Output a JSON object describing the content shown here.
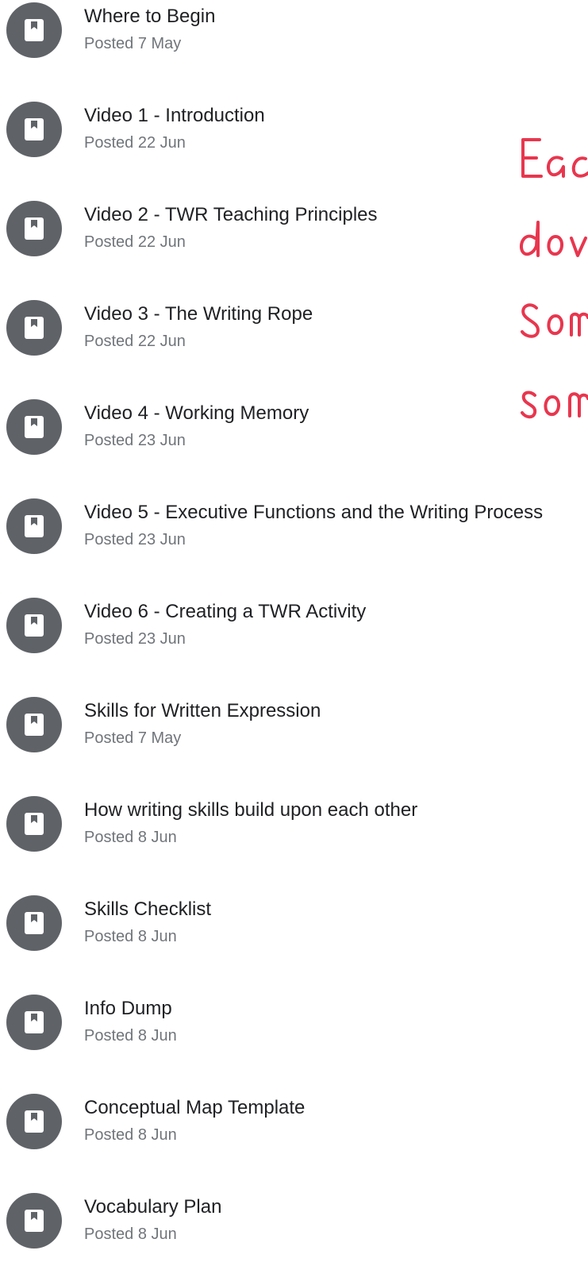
{
  "materials": [
    {
      "title": "Where to Begin",
      "date": "Posted 7 May"
    },
    {
      "title": "Video 1 - Introduction",
      "date": "Posted 22 Jun"
    },
    {
      "title": "Video 2 - TWR Teaching Principles",
      "date": "Posted 22 Jun"
    },
    {
      "title": "Video 3 - The Writing Rope",
      "date": "Posted 22 Jun"
    },
    {
      "title": "Video 4 - Working Memory",
      "date": "Posted 23 Jun"
    },
    {
      "title": "Video 5 - Executive Functions and the Writing Process",
      "date": "Posted 23 Jun"
    },
    {
      "title": "Video 6 - Creating a TWR Activity",
      "date": "Posted 23 Jun"
    },
    {
      "title": "Skills for Written Expression",
      "date": "Posted 7 May"
    },
    {
      "title": "How writing skills build upon each other",
      "date": "Posted 8 Jun"
    },
    {
      "title": "Skills Checklist",
      "date": "Posted 8 Jun"
    },
    {
      "title": "Info Dump",
      "date": "Posted 8 Jun"
    },
    {
      "title": "Conceptual Map Template",
      "date": "Posted 8 Jun"
    },
    {
      "title": "Vocabulary Plan",
      "date": "Posted 8 Jun"
    }
  ],
  "icon": "bookmark-material-icon",
  "colors": {
    "icon_bg": "#5f6368",
    "title": "#202124",
    "date": "#70757a",
    "annotation": "#e8364e"
  }
}
